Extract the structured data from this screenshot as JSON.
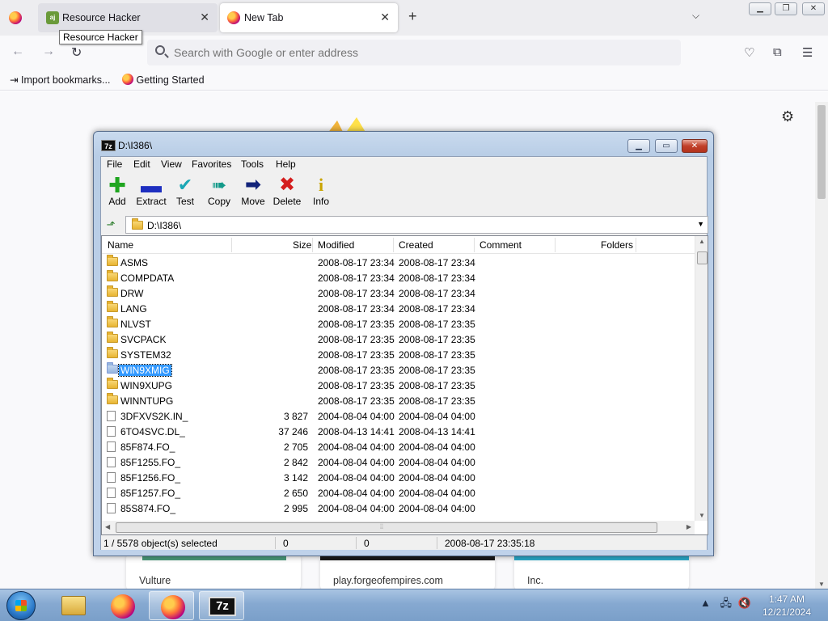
{
  "browser": {
    "tabs": [
      {
        "title": "Resource Hacker",
        "active": false
      },
      {
        "title": "New Tab",
        "active": true
      }
    ],
    "tooltip": "Resource Hacker",
    "urlbar_placeholder": "Search with Google or enter address",
    "bookmarks": [
      {
        "label": "Import bookmarks...",
        "icon": "import-icon"
      },
      {
        "label": "Getting Started",
        "icon": "firefox-icon"
      }
    ],
    "shortcuts": [
      {
        "label": "Vulture"
      },
      {
        "label": "play.forgeofempires.com"
      },
      {
        "label": "Inc."
      }
    ]
  },
  "zip": {
    "title": "D:\\I386\\",
    "menu": [
      "File",
      "Edit",
      "View",
      "Favorites",
      "Tools",
      "Help"
    ],
    "toolbar": [
      {
        "label": "Add",
        "icon": "plus-icon",
        "color": "#1fa51f"
      },
      {
        "label": "Extract",
        "icon": "minus-icon",
        "color": "#1e2fc0"
      },
      {
        "label": "Test",
        "icon": "checkmark-icon",
        "color": "#1aa7b5"
      },
      {
        "label": "Copy",
        "icon": "double-arrow-icon",
        "color": "#139a8a"
      },
      {
        "label": "Move",
        "icon": "arrow-right-icon",
        "color": "#12237a"
      },
      {
        "label": "Delete",
        "icon": "x-icon",
        "color": "#d41c1c"
      },
      {
        "label": "Info",
        "icon": "info-icon",
        "color": "#d8b400"
      }
    ],
    "address": "D:\\I386\\",
    "columns": [
      "Name",
      "Size",
      "Modified",
      "Created",
      "Comment",
      "Folders"
    ],
    "rows": [
      {
        "name": "ASMS",
        "type": "folder",
        "size": "",
        "modified": "2008-08-17 23:34",
        "created": "2008-08-17 23:34"
      },
      {
        "name": "COMPDATA",
        "type": "folder",
        "size": "",
        "modified": "2008-08-17 23:34",
        "created": "2008-08-17 23:34"
      },
      {
        "name": "DRW",
        "type": "folder",
        "size": "",
        "modified": "2008-08-17 23:34",
        "created": "2008-08-17 23:34"
      },
      {
        "name": "LANG",
        "type": "folder",
        "size": "",
        "modified": "2008-08-17 23:34",
        "created": "2008-08-17 23:34"
      },
      {
        "name": "NLVST",
        "type": "folder",
        "size": "",
        "modified": "2008-08-17 23:35",
        "created": "2008-08-17 23:35"
      },
      {
        "name": "SVCPACK",
        "type": "folder",
        "size": "",
        "modified": "2008-08-17 23:35",
        "created": "2008-08-17 23:35"
      },
      {
        "name": "SYSTEM32",
        "type": "folder",
        "size": "",
        "modified": "2008-08-17 23:35",
        "created": "2008-08-17 23:35"
      },
      {
        "name": "WIN9XMIG",
        "type": "folder",
        "size": "",
        "modified": "2008-08-17 23:35",
        "created": "2008-08-17 23:35",
        "selected": true
      },
      {
        "name": "WIN9XUPG",
        "type": "folder",
        "size": "",
        "modified": "2008-08-17 23:35",
        "created": "2008-08-17 23:35"
      },
      {
        "name": "WINNTUPG",
        "type": "folder",
        "size": "",
        "modified": "2008-08-17 23:35",
        "created": "2008-08-17 23:35"
      },
      {
        "name": "3DFXVS2K.IN_",
        "type": "file",
        "size": "3 827",
        "modified": "2004-08-04 04:00",
        "created": "2004-08-04 04:00"
      },
      {
        "name": "6TO4SVC.DL_",
        "type": "file",
        "size": "37 246",
        "modified": "2008-04-13 14:41",
        "created": "2008-04-13 14:41"
      },
      {
        "name": "85F874.FO_",
        "type": "file",
        "size": "2 705",
        "modified": "2004-08-04 04:00",
        "created": "2004-08-04 04:00"
      },
      {
        "name": "85F1255.FO_",
        "type": "file",
        "size": "2 842",
        "modified": "2004-08-04 04:00",
        "created": "2004-08-04 04:00"
      },
      {
        "name": "85F1256.FO_",
        "type": "file",
        "size": "3 142",
        "modified": "2004-08-04 04:00",
        "created": "2004-08-04 04:00"
      },
      {
        "name": "85F1257.FO_",
        "type": "file",
        "size": "2 650",
        "modified": "2004-08-04 04:00",
        "created": "2004-08-04 04:00"
      },
      {
        "name": "85S874.FO_",
        "type": "file",
        "size": "2 995",
        "modified": "2004-08-04 04:00",
        "created": "2004-08-04 04:00"
      }
    ],
    "status": {
      "selection": "1 / 5578 object(s) selected",
      "size": "0",
      "packed": "0",
      "modified": "2008-08-17 23:35:18"
    }
  },
  "taskbar": {
    "apps": [
      {
        "icon": "explorer-icon"
      },
      {
        "icon": "firefox-icon"
      },
      {
        "icon": "firefox-icon",
        "active": true
      },
      {
        "icon": "7zip-icon",
        "label": "7z",
        "active": true
      }
    ],
    "time": "1:47 AM",
    "date": "12/21/2024"
  }
}
